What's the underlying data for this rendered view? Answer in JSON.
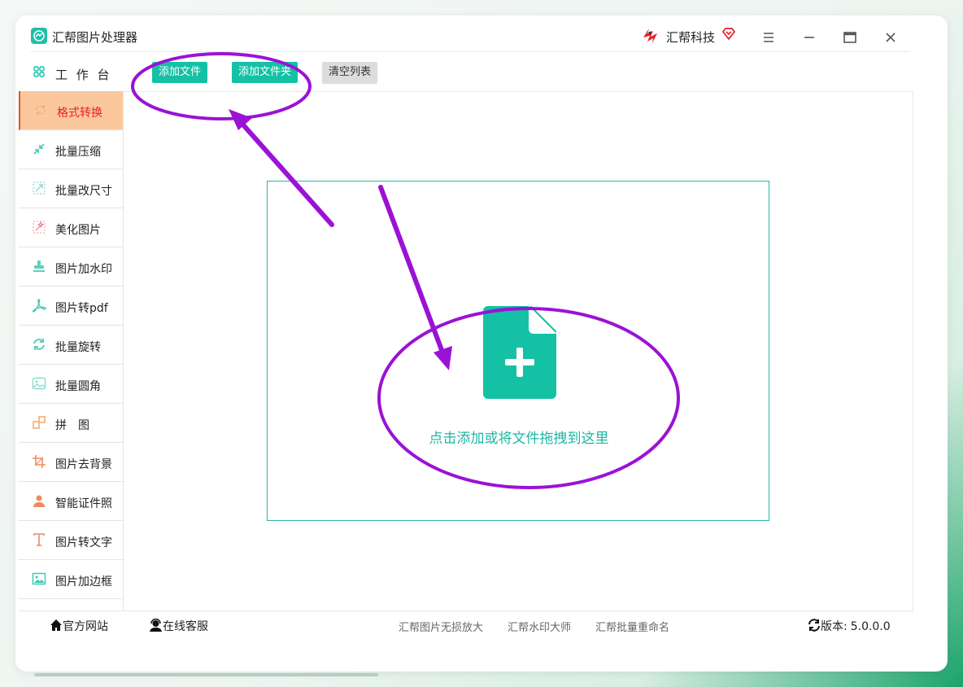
{
  "app": {
    "title": "汇帮图片处理器",
    "brand": "汇帮科技"
  },
  "window_controls": [
    "menu-icon",
    "minimize-icon",
    "maximize-icon",
    "close-icon"
  ],
  "sidebar": {
    "workbench": "工 作 台",
    "items": [
      {
        "label": "格式转换",
        "icon": "convert-icon",
        "active": true
      },
      {
        "label": "批量压缩",
        "icon": "compress-icon"
      },
      {
        "label": "批量改尺寸",
        "icon": "resize-icon"
      },
      {
        "label": "美化图片",
        "icon": "beautify-icon"
      },
      {
        "label": "图片加水印",
        "icon": "watermark-icon"
      },
      {
        "label": "图片转pdf",
        "icon": "pdf-icon"
      },
      {
        "label": "批量旋转",
        "icon": "rotate-icon"
      },
      {
        "label": "批量圆角",
        "icon": "rounded-corner-icon"
      },
      {
        "label": "拼　图",
        "icon": "collage-icon"
      },
      {
        "label": "图片去背景",
        "icon": "crop-icon"
      },
      {
        "label": "智能证件照",
        "icon": "person-icon"
      },
      {
        "label": "图片转文字",
        "icon": "text-icon"
      },
      {
        "label": "图片加边框",
        "icon": "frame-icon"
      }
    ]
  },
  "toolbar": {
    "add_file": "添加文件",
    "add_folder": "添加文件夹",
    "clear_list": "清空列表"
  },
  "dropzone": {
    "text": "点击添加或将文件拖拽到这里"
  },
  "footer": {
    "website": "官方网站",
    "support": "在线客服",
    "links": [
      "汇帮图片无损放大",
      "汇帮水印大师",
      "汇帮批量重命名"
    ],
    "version_label": "版本:",
    "version": "5.0.0.0"
  },
  "colors": {
    "accent": "#14c1a5",
    "active_bg": "#fbc89e",
    "active_text": "#e8202c",
    "annotation": "#9b12d6"
  }
}
